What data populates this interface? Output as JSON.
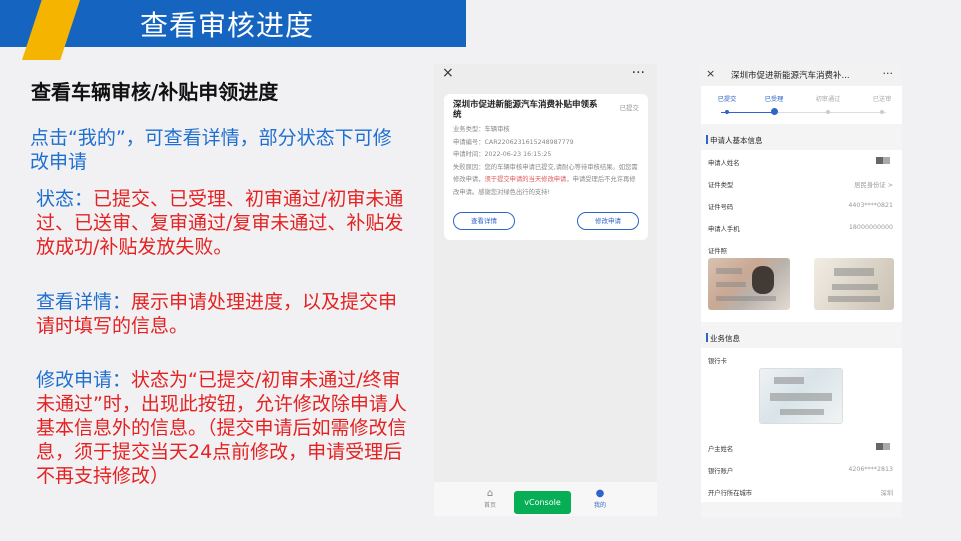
{
  "header": {
    "title": "查看审核进度"
  },
  "left": {
    "heading": "查看车辆审核/补贴申领进度",
    "intro": "点击“我的”，可查看详情，部分状态下可修改申请",
    "status_label": "状态：",
    "status_text": "已提交、已受理、初审通过/初审未通过、已送审、复审通过/复审未通过、补贴发放成功/补贴发放失败。",
    "detail_label": "查看详情：",
    "detail_text": "展示申请处理进度，以及提交申请时填写的信息。",
    "edit_label": "修改申请：",
    "edit_text": "状态为“已提交/初审未通过/终审未通过”时，出现此按钮，允许修改除申请人基本信息外的信息。（提交申请后如需修改信息，须于提交当天24点前修改，申请受理后不再支持修改）"
  },
  "phone1": {
    "close_icon": "×",
    "more_icon": "···",
    "card": {
      "title": "深圳市促进新能源汽车消费补贴申领系统",
      "status": "已提交",
      "business_type": "业务类型：车辆审核",
      "app_no": "申请编号：CAR2206231615248987779",
      "app_time": "申请时间：2022-06-23 16:15:25",
      "reason_prefix": "失败原因：您的车辆审核申请已提交,请耐心等待审核结果。如您需修改申请，",
      "reason_highlight": "须于提交申请的当天修改申请",
      "reason_suffix": "，申请受理后不允许再修改申请。感谢您对绿色出行的支持!",
      "detail_button": "查看详情",
      "edit_button": "修改申请"
    },
    "tabbar": {
      "home_label": "首页",
      "home_icon": "⌂",
      "mine_label": "我的",
      "mine_icon": "●",
      "vconsole": "vConsole"
    }
  },
  "phone2": {
    "close_icon": "×",
    "title": "深圳市促进新能源汽车消费补...",
    "more_icon": "···",
    "steps": [
      "已提交",
      "已受理",
      "初审通过",
      "已送审"
    ],
    "basic_section": "申请人基本信息",
    "basic_rows": [
      {
        "key": "申请人姓名",
        "value": ""
      },
      {
        "key": "证件类型",
        "value": "居民身份证 >"
      },
      {
        "key": "证件号码",
        "value": "4403****0821"
      },
      {
        "key": "申请人手机",
        "value": "18000000000"
      }
    ],
    "id_photo_label": "证件照",
    "business_section": "业务信息",
    "bank_card_label": "银行卡",
    "account_rows": [
      {
        "key": "户主姓名",
        "value": ""
      },
      {
        "key": "银行账户",
        "value": "4206****2813"
      },
      {
        "key": "开户行所在城市",
        "value": "深圳"
      }
    ]
  }
}
